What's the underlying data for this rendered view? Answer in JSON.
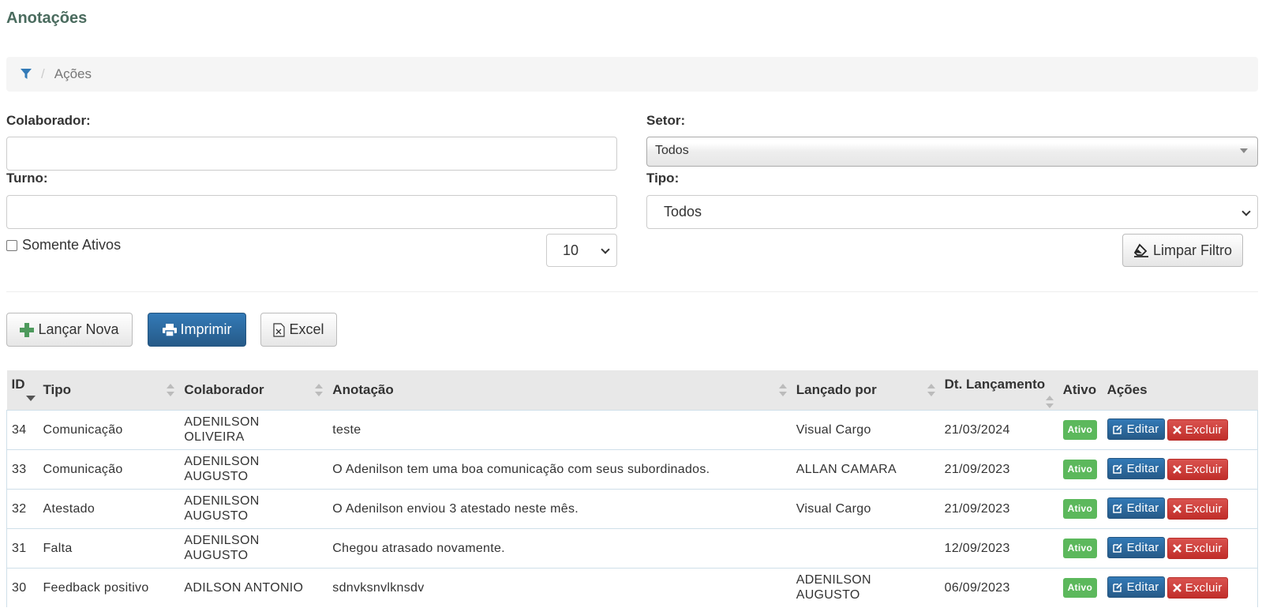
{
  "page": {
    "title": "Anotações"
  },
  "breadcrumb": {
    "icon": "filter-icon",
    "current": "Ações"
  },
  "filters": {
    "colaborador_label": "Colaborador:",
    "colaborador_value": "",
    "turno_label": "Turno:",
    "turno_value": "",
    "setor_label": "Setor:",
    "setor_value": "Todos",
    "tipo_label": "Tipo:",
    "tipo_value": "Todos",
    "somente_ativos_label": "Somente Ativos",
    "somente_ativos_checked": false,
    "page_size": "10",
    "clear_label": "Limpar Filtro"
  },
  "toolbar": {
    "new_label": "Lançar Nova",
    "print_label": "Imprimir",
    "excel_label": "Excel"
  },
  "table": {
    "columns": [
      "ID",
      "Tipo",
      "Colaborador",
      "Anotação",
      "Lançado por",
      "Dt. Lançamento",
      "Ativo",
      "Ações"
    ],
    "edit_label": "Editar",
    "delete_label": "Excluir",
    "rows": [
      {
        "id": "34",
        "tipo": "Comunicação",
        "colaborador": "ADENILSON OLIVEIRA",
        "anotacao": "teste",
        "lancado_por": "Visual Cargo",
        "data": "21/03/2024",
        "ativo": "Ativo"
      },
      {
        "id": "33",
        "tipo": "Comunicação",
        "colaborador": "ADENILSON AUGUSTO",
        "anotacao": "O Adenilson tem uma boa comunicação com seus subordinados.",
        "lancado_por": "ALLAN CAMARA",
        "data": "21/09/2023",
        "ativo": "Ativo"
      },
      {
        "id": "32",
        "tipo": "Atestado",
        "colaborador": "ADENILSON AUGUSTO",
        "anotacao": "O Adenilson enviou 3 atestado neste mês.",
        "lancado_por": "Visual Cargo",
        "data": "21/09/2023",
        "ativo": "Ativo"
      },
      {
        "id": "31",
        "tipo": "Falta",
        "colaborador": "ADENILSON AUGUSTO",
        "anotacao": "Chegou atrasado novamente.",
        "lancado_por": "",
        "data": "12/09/2023",
        "ativo": "Ativo"
      },
      {
        "id": "30",
        "tipo": "Feedback positivo",
        "colaborador": "ADILSON ANTONIO",
        "anotacao": "sdnvksnvlknsdv",
        "lancado_por": "ADENILSON AUGUSTO",
        "data": "06/09/2023",
        "ativo": "Ativo"
      }
    ]
  },
  "colors": {
    "primary": "#337ab7",
    "danger": "#d9534f",
    "success": "#5cb85c",
    "title": "#4a6b5e"
  }
}
